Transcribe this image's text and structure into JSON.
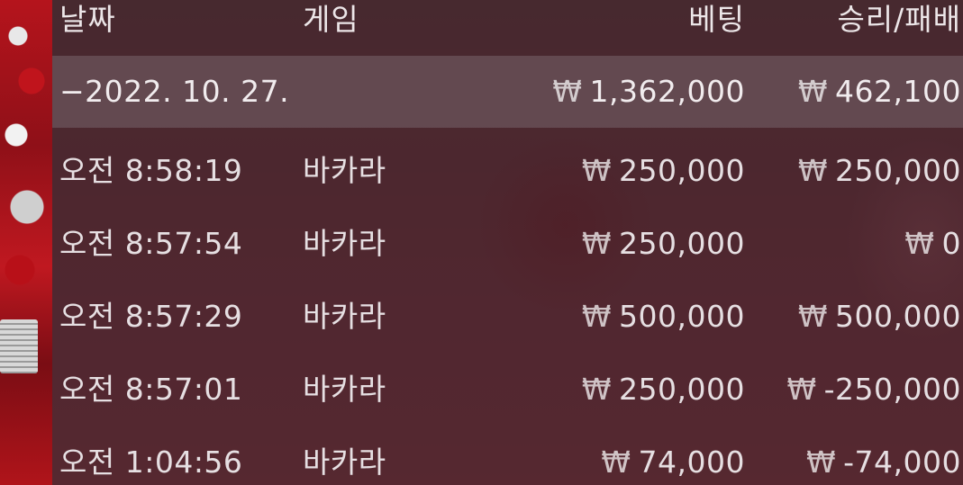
{
  "header": {
    "date": "날짜",
    "game": "게임",
    "bet": "베팅",
    "win_loss": "승리/패배"
  },
  "summary": {
    "date": "−2022. 10. 27.",
    "currency": "₩",
    "bet": "1,362,000",
    "win_loss": "462,100"
  },
  "rows": [
    {
      "time": "오전 8:58:19",
      "game": "바카라",
      "currency": "₩",
      "bet": "250,000",
      "win_loss": "250,000"
    },
    {
      "time": "오전 8:57:54",
      "game": "바카라",
      "currency": "₩",
      "bet": "250,000",
      "win_loss": "0"
    },
    {
      "time": "오전 8:57:29",
      "game": "바카라",
      "currency": "₩",
      "bet": "500,000",
      "win_loss": "500,000"
    },
    {
      "time": "오전 8:57:01",
      "game": "바카라",
      "currency": "₩",
      "bet": "250,000",
      "win_loss": "-250,000"
    },
    {
      "time": "오전 1:04:56",
      "game": "바카라",
      "currency": "₩",
      "bet": "74,000",
      "win_loss": "-74,000"
    }
  ]
}
